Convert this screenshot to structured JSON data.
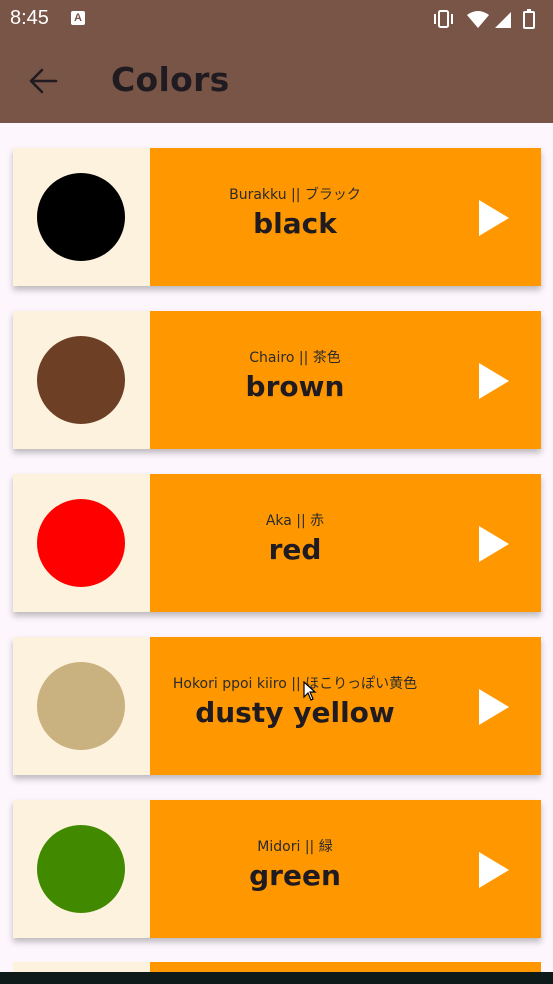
{
  "status_bar": {
    "time": "8:45",
    "notification_icon": "text-a-icon"
  },
  "app_bar": {
    "title": "Colors",
    "back_icon": "arrow-back-icon"
  },
  "colors": [
    {
      "romaji_jp": "Burakku || ブラック",
      "name": "black",
      "swatch": "#000000"
    },
    {
      "romaji_jp": "Chairo || 茶色",
      "name": "brown",
      "swatch": "#6d4026"
    },
    {
      "romaji_jp": "Aka || 赤",
      "name": "red",
      "swatch": "#ff0000"
    },
    {
      "romaji_jp": "Hokori ppoi kiiro || ほこりっぽい黄色",
      "name": "dusty yellow",
      "swatch": "#c9b180"
    },
    {
      "romaji_jp": "Midori || 緑",
      "name": "green",
      "swatch": "#418a00"
    }
  ],
  "theme": {
    "app_bar": "#795548",
    "card_panel": "#ff9800",
    "swatch_bg": "#fdf2dd"
  }
}
